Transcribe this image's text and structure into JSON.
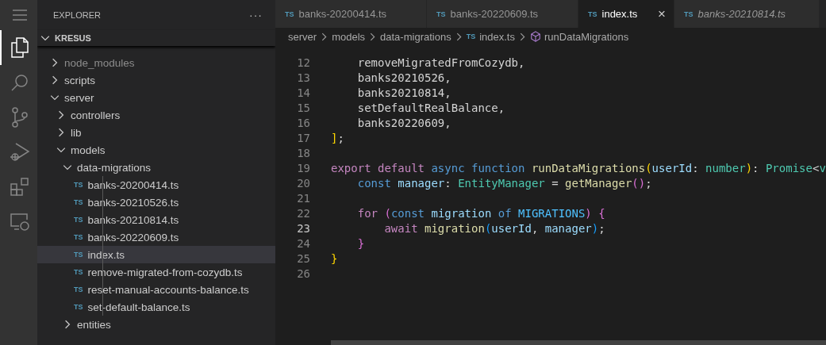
{
  "activity_bar": [
    {
      "kind": "menu",
      "selected": false
    },
    {
      "kind": "files",
      "selected": true
    },
    {
      "kind": "search",
      "selected": false
    },
    {
      "kind": "source-control",
      "selected": false
    },
    {
      "kind": "run-debug",
      "selected": false
    },
    {
      "kind": "extensions",
      "selected": false
    },
    {
      "kind": "remote",
      "selected": false
    }
  ],
  "sidebar": {
    "title": "EXPLORER",
    "more": "···",
    "section": "KRESUS",
    "section_expanded": true,
    "tree": [
      {
        "label": "node_modules",
        "kind": "folder",
        "expanded": false,
        "dimmed": true,
        "selected": false
      },
      {
        "label": "scripts",
        "kind": "folder",
        "expanded": false,
        "dimmed": false,
        "selected": false
      },
      {
        "label": "server",
        "kind": "folder",
        "expanded": true,
        "dimmed": false,
        "selected": false,
        "children": [
          {
            "label": "controllers",
            "kind": "folder",
            "expanded": false,
            "dimmed": false,
            "selected": false
          },
          {
            "label": "lib",
            "kind": "folder",
            "expanded": false,
            "dimmed": false,
            "selected": false
          },
          {
            "label": "models",
            "kind": "folder",
            "expanded": true,
            "dimmed": false,
            "selected": false,
            "children": [
              {
                "label": "data-migrations",
                "kind": "folder",
                "expanded": true,
                "dimmed": false,
                "selected": false,
                "children": [
                  {
                    "label": "banks-20200414.ts",
                    "kind": "file",
                    "badge": "TS",
                    "dimmed": false,
                    "selected": false
                  },
                  {
                    "label": "banks-20210526.ts",
                    "kind": "file",
                    "badge": "TS",
                    "dimmed": false,
                    "selected": false
                  },
                  {
                    "label": "banks-20210814.ts",
                    "kind": "file",
                    "badge": "TS",
                    "dimmed": false,
                    "selected": false
                  },
                  {
                    "label": "banks-20220609.ts",
                    "kind": "file",
                    "badge": "TS",
                    "dimmed": false,
                    "selected": false
                  },
                  {
                    "label": "index.ts",
                    "kind": "file",
                    "badge": "TS",
                    "dimmed": false,
                    "selected": true
                  },
                  {
                    "label": "remove-migrated-from-cozydb.ts",
                    "kind": "file",
                    "badge": "TS",
                    "dimmed": false,
                    "selected": false
                  },
                  {
                    "label": "reset-manual-accounts-balance.ts",
                    "kind": "file",
                    "badge": "TS",
                    "dimmed": false,
                    "selected": false
                  },
                  {
                    "label": "set-default-balance.ts",
                    "kind": "file",
                    "badge": "TS",
                    "dimmed": false,
                    "selected": false
                  }
                ]
              },
              {
                "label": "entities",
                "kind": "folder",
                "expanded": false,
                "dimmed": false,
                "selected": false
              }
            ]
          }
        ]
      }
    ]
  },
  "tabs": [
    {
      "badge": "TS",
      "label": "banks-20200414.ts",
      "selected": false,
      "preview": false
    },
    {
      "badge": "TS",
      "label": "banks-20220609.ts",
      "selected": false,
      "preview": false
    },
    {
      "badge": "TS",
      "label": "index.ts",
      "selected": true,
      "preview": false,
      "close": "×"
    },
    {
      "badge": "TS",
      "label": "banks-20210814.ts",
      "selected": false,
      "preview": true
    }
  ],
  "breadcrumb": [
    {
      "kind": "folder",
      "label": "server"
    },
    {
      "kind": "folder",
      "label": "models"
    },
    {
      "kind": "folder",
      "label": "data-migrations"
    },
    {
      "kind": "file",
      "badge": "TS",
      "label": "index.ts"
    },
    {
      "kind": "symbol",
      "label": "runDataMigrations"
    }
  ],
  "code": [
    {
      "number": "12",
      "current": false,
      "tokens": [
        {
          "kind": "plain",
          "text": "    removeMigratedFromCozydb,"
        }
      ]
    },
    {
      "number": "13",
      "current": false,
      "tokens": [
        {
          "kind": "plain",
          "text": "    banks20210526,"
        }
      ]
    },
    {
      "number": "14",
      "current": false,
      "tokens": [
        {
          "kind": "plain",
          "text": "    banks20210814,"
        }
      ]
    },
    {
      "number": "15",
      "current": false,
      "tokens": [
        {
          "kind": "plain",
          "text": "    setDefaultRealBalance,"
        }
      ]
    },
    {
      "number": "16",
      "current": false,
      "tokens": [
        {
          "kind": "plain",
          "text": "    banks20220609,"
        }
      ]
    },
    {
      "number": "17",
      "current": false,
      "tokens": [
        {
          "kind": "bracket1",
          "text": "]"
        },
        {
          "kind": "plain",
          "text": ";"
        }
      ]
    },
    {
      "number": "18",
      "current": false
    },
    {
      "number": "19",
      "current": false,
      "tokens": [
        {
          "kind": "control",
          "text": "export default"
        },
        {
          "kind": "storage",
          "text": " async function"
        },
        {
          "kind": "func",
          "text": " runDataMigrations"
        },
        {
          "kind": "bracket1",
          "text": "("
        },
        {
          "kind": "var",
          "text": "userId"
        },
        {
          "kind": "plain",
          "text": ":"
        },
        {
          "kind": "type",
          "text": " number"
        },
        {
          "kind": "bracket1",
          "text": ")"
        },
        {
          "kind": "plain",
          "text": ":"
        },
        {
          "kind": "type",
          "text": " Promise"
        },
        {
          "kind": "plain",
          "text": "<"
        },
        {
          "kind": "type",
          "text": "v"
        }
      ]
    },
    {
      "number": "20",
      "current": false,
      "tokens": [
        {
          "kind": "storage",
          "text": "    const"
        },
        {
          "kind": "var",
          "text": " manager"
        },
        {
          "kind": "plain",
          "text": ":"
        },
        {
          "kind": "type",
          "text": " EntityManager"
        },
        {
          "kind": "plain",
          "text": " ="
        },
        {
          "kind": "func",
          "text": " getManager"
        },
        {
          "kind": "bracket2",
          "text": "()"
        },
        {
          "kind": "plain",
          "text": ";"
        }
      ]
    },
    {
      "number": "21",
      "current": false
    },
    {
      "number": "22",
      "current": false,
      "tokens": [
        {
          "kind": "control",
          "text": "    for"
        },
        {
          "kind": "bracket2",
          "text": " ("
        },
        {
          "kind": "storage",
          "text": "const"
        },
        {
          "kind": "var",
          "text": " migration"
        },
        {
          "kind": "storage",
          "text": " of"
        },
        {
          "kind": "const",
          "text": " MIGRATIONS"
        },
        {
          "kind": "bracket2",
          "text": ")"
        },
        {
          "kind": "bracket2",
          "text": " {"
        }
      ]
    },
    {
      "number": "23",
      "current": true,
      "tokens": [
        {
          "kind": "control",
          "text": "        await"
        },
        {
          "kind": "func",
          "text": " migration"
        },
        {
          "kind": "bracket3",
          "text": "("
        },
        {
          "kind": "var",
          "text": "userId"
        },
        {
          "kind": "plain",
          "text": ","
        },
        {
          "kind": "var",
          "text": " manager"
        },
        {
          "kind": "bracket3",
          "text": ")"
        },
        {
          "kind": "plain",
          "text": ";"
        }
      ]
    },
    {
      "number": "24",
      "current": false,
      "tokens": [
        {
          "kind": "bracket2",
          "text": "    }"
        }
      ]
    },
    {
      "number": "25",
      "current": false,
      "tokens": [
        {
          "kind": "bracket1",
          "text": "}"
        }
      ]
    },
    {
      "number": "26",
      "current": false
    }
  ]
}
